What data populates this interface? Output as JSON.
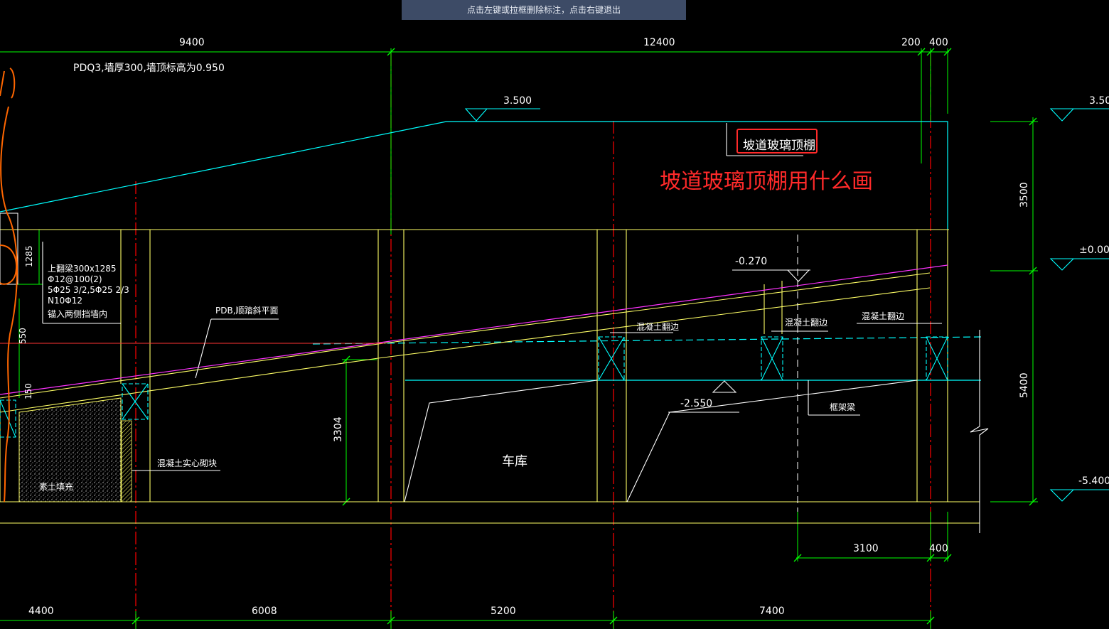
{
  "hint_bar": "点击左键或拉框删除标注，点击右键退出",
  "colors": {
    "background": "#000000",
    "white": "#ffffff",
    "green": "#00ff00",
    "yellow": "#ffff66",
    "cyan": "#00ffff",
    "magenta": "#ff33ff",
    "red": "#ff0000",
    "orange": "#ff6600",
    "annotation_red": "#ff2a2a"
  },
  "dims_top": {
    "d1": "9400",
    "d2": "12400",
    "d3": "200",
    "d4": "400"
  },
  "dims_bottom": {
    "d1": "4400",
    "d2": "6008",
    "d3": "5200",
    "d4": "7400"
  },
  "dims_right_lower": {
    "d1": "3100",
    "d2": "400"
  },
  "dims_vertical": {
    "v1": "3500",
    "v2": "5400",
    "v3": "3304",
    "v4": "1285",
    "v5": "550",
    "v6": "150"
  },
  "elevations": {
    "e1": "3.500",
    "e2": "3.50",
    "e3": "±0.000",
    "e4": "-0.270",
    "e5": "-2.550",
    "e6": "-5.400"
  },
  "notes": {
    "pdq3": "PDQ3,墙厚300,墙顶标高为0.950",
    "beam_1": "上翻梁300x1285",
    "beam_2": "Φ12@100(2)",
    "beam_3": "5Φ25 3/2,5Φ25 2/3",
    "beam_4": "N10Φ12",
    "beam_5": "锚入两侧挡墙内",
    "pdb": "PDB,顺踏斜平面",
    "edge_1": "混凝土翻边",
    "edge_2": "混凝土翻边",
    "edge_3": "混凝土翻边",
    "frame_beam": "框架梁",
    "garage": "车库",
    "solid_block": "混凝土实心砌块",
    "soil_fill": "素土填充",
    "canopy_label": "坡道玻璃顶棚",
    "question": "坡道玻璃顶棚用什么画"
  }
}
